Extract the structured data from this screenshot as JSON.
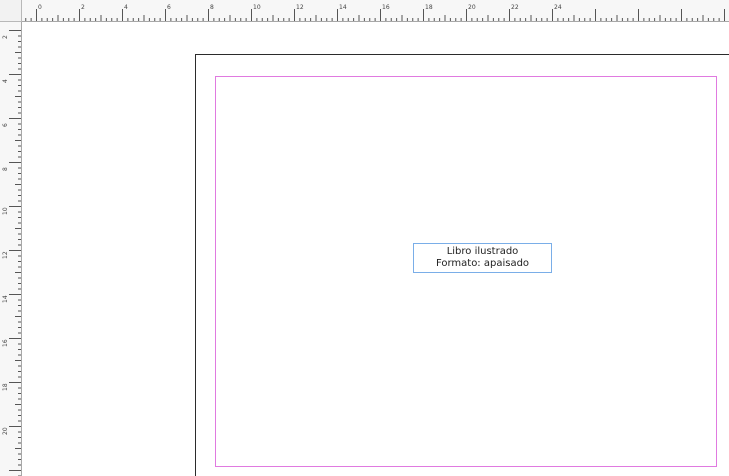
{
  "document": {
    "text_frame": {
      "line1": "Libro ilustrado",
      "line2": "Formato: apaisado"
    },
    "margin_guide_color": "#e07ae0",
    "frame_edge_color": "#7aaee8"
  },
  "rulers": {
    "horizontal_labels": [
      "0",
      "2",
      "4",
      "6",
      "8",
      "10",
      "12",
      "14",
      "16",
      "18",
      "20",
      "22",
      "24"
    ],
    "vertical_labels": [
      "2",
      "4",
      "6",
      "8",
      "10",
      "12",
      "14",
      "16",
      "18",
      "20"
    ]
  }
}
